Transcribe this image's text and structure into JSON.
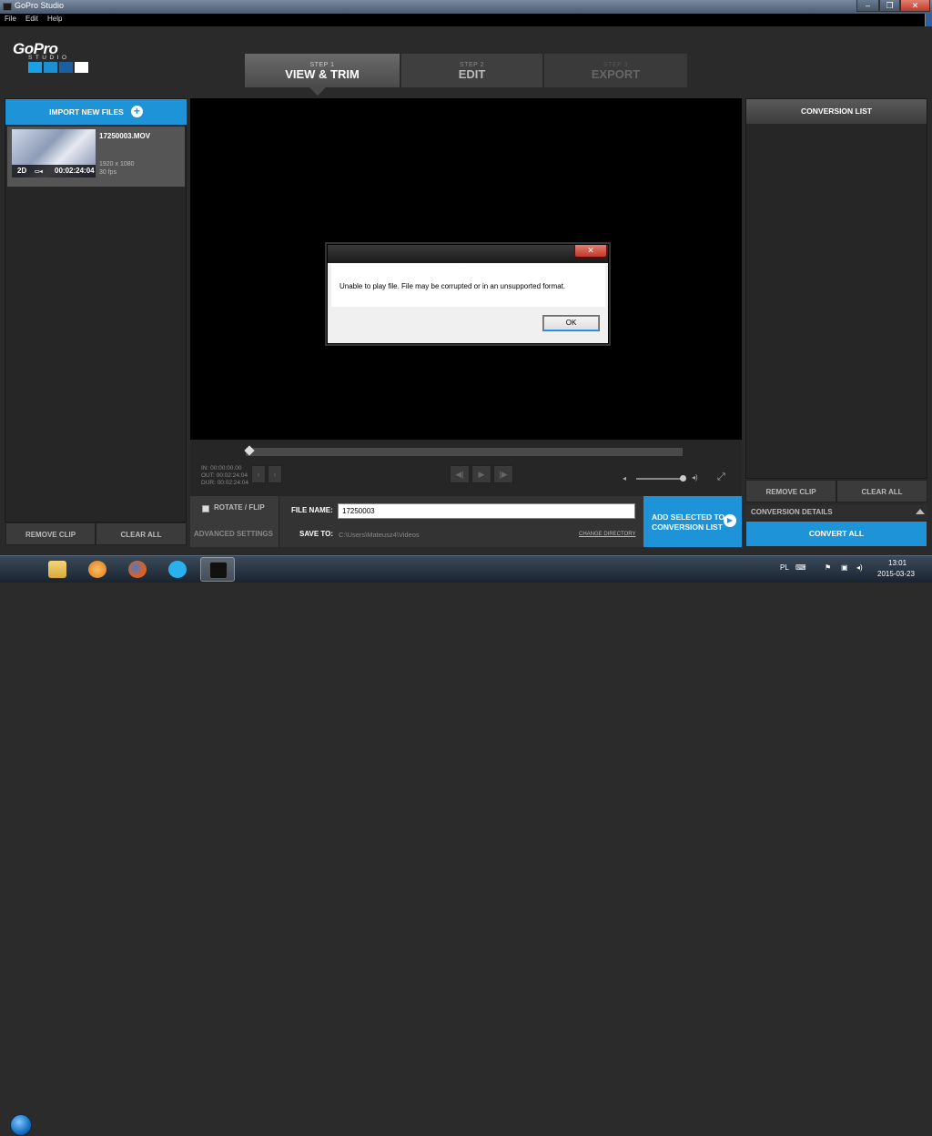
{
  "window": {
    "title": "GoPro Studio",
    "btn_min": "–",
    "btn_max": "❐",
    "btn_close": "✕"
  },
  "menu": {
    "file": "File",
    "edit": "Edit",
    "help": "Help"
  },
  "logo": {
    "word": "GoPro",
    "sub": "STUDIO",
    "colors": [
      "#1ba0e5",
      "#1b8fd0",
      "#1b5fa0",
      "#ffffff"
    ]
  },
  "steps": [
    {
      "num": "STEP 1",
      "label": "VIEW & TRIM"
    },
    {
      "num": "STEP 2",
      "label": "EDIT"
    },
    {
      "num": "STEP 3",
      "label": "EXPORT"
    }
  ],
  "left": {
    "import_label": "IMPORT NEW FILES",
    "clip": {
      "name": "17250003.MOV",
      "badge": "2D",
      "duration": "00:02:24:04",
      "resolution": "1920 x 1080",
      "fps": "30 fps"
    },
    "remove_clip": "REMOVE CLIP",
    "clear_all": "CLEAR ALL"
  },
  "timecodes": {
    "in": "IN: 00:00:00.00",
    "out": "OUT: 00:02:24:04",
    "dur": "DUR: 00:02:24:04"
  },
  "playback": {
    "prev": "◀|",
    "play": "▶",
    "next": "|▶"
  },
  "bottom": {
    "rotate_label": "ROTATE / FLIP",
    "advanced_label": "ADVANCED SETTINGS",
    "file_name_label": "FILE NAME:",
    "file_name_value": "17250003",
    "save_to_label": "SAVE TO:",
    "save_to_path": "C:\\Users\\Mateusz4\\Videos",
    "change_dir": "CHANGE DIRECTORY",
    "add_line1": "ADD SELECTED TO",
    "add_line2": "CONVERSION LIST"
  },
  "right": {
    "header": "CONVERSION LIST",
    "remove_clip": "REMOVE CLIP",
    "clear_all": "CLEAR ALL",
    "details": "CONVERSION DETAILS",
    "convert_all": "CONVERT ALL"
  },
  "dialog": {
    "message": "Unable to play file. File may be corrupted or in an unsupported format.",
    "ok": "OK",
    "close": "✕"
  },
  "taskbar": {
    "lang": "PL",
    "time": "13:01",
    "date": "2015-03-23"
  },
  "accent_color": "#1f93d7"
}
